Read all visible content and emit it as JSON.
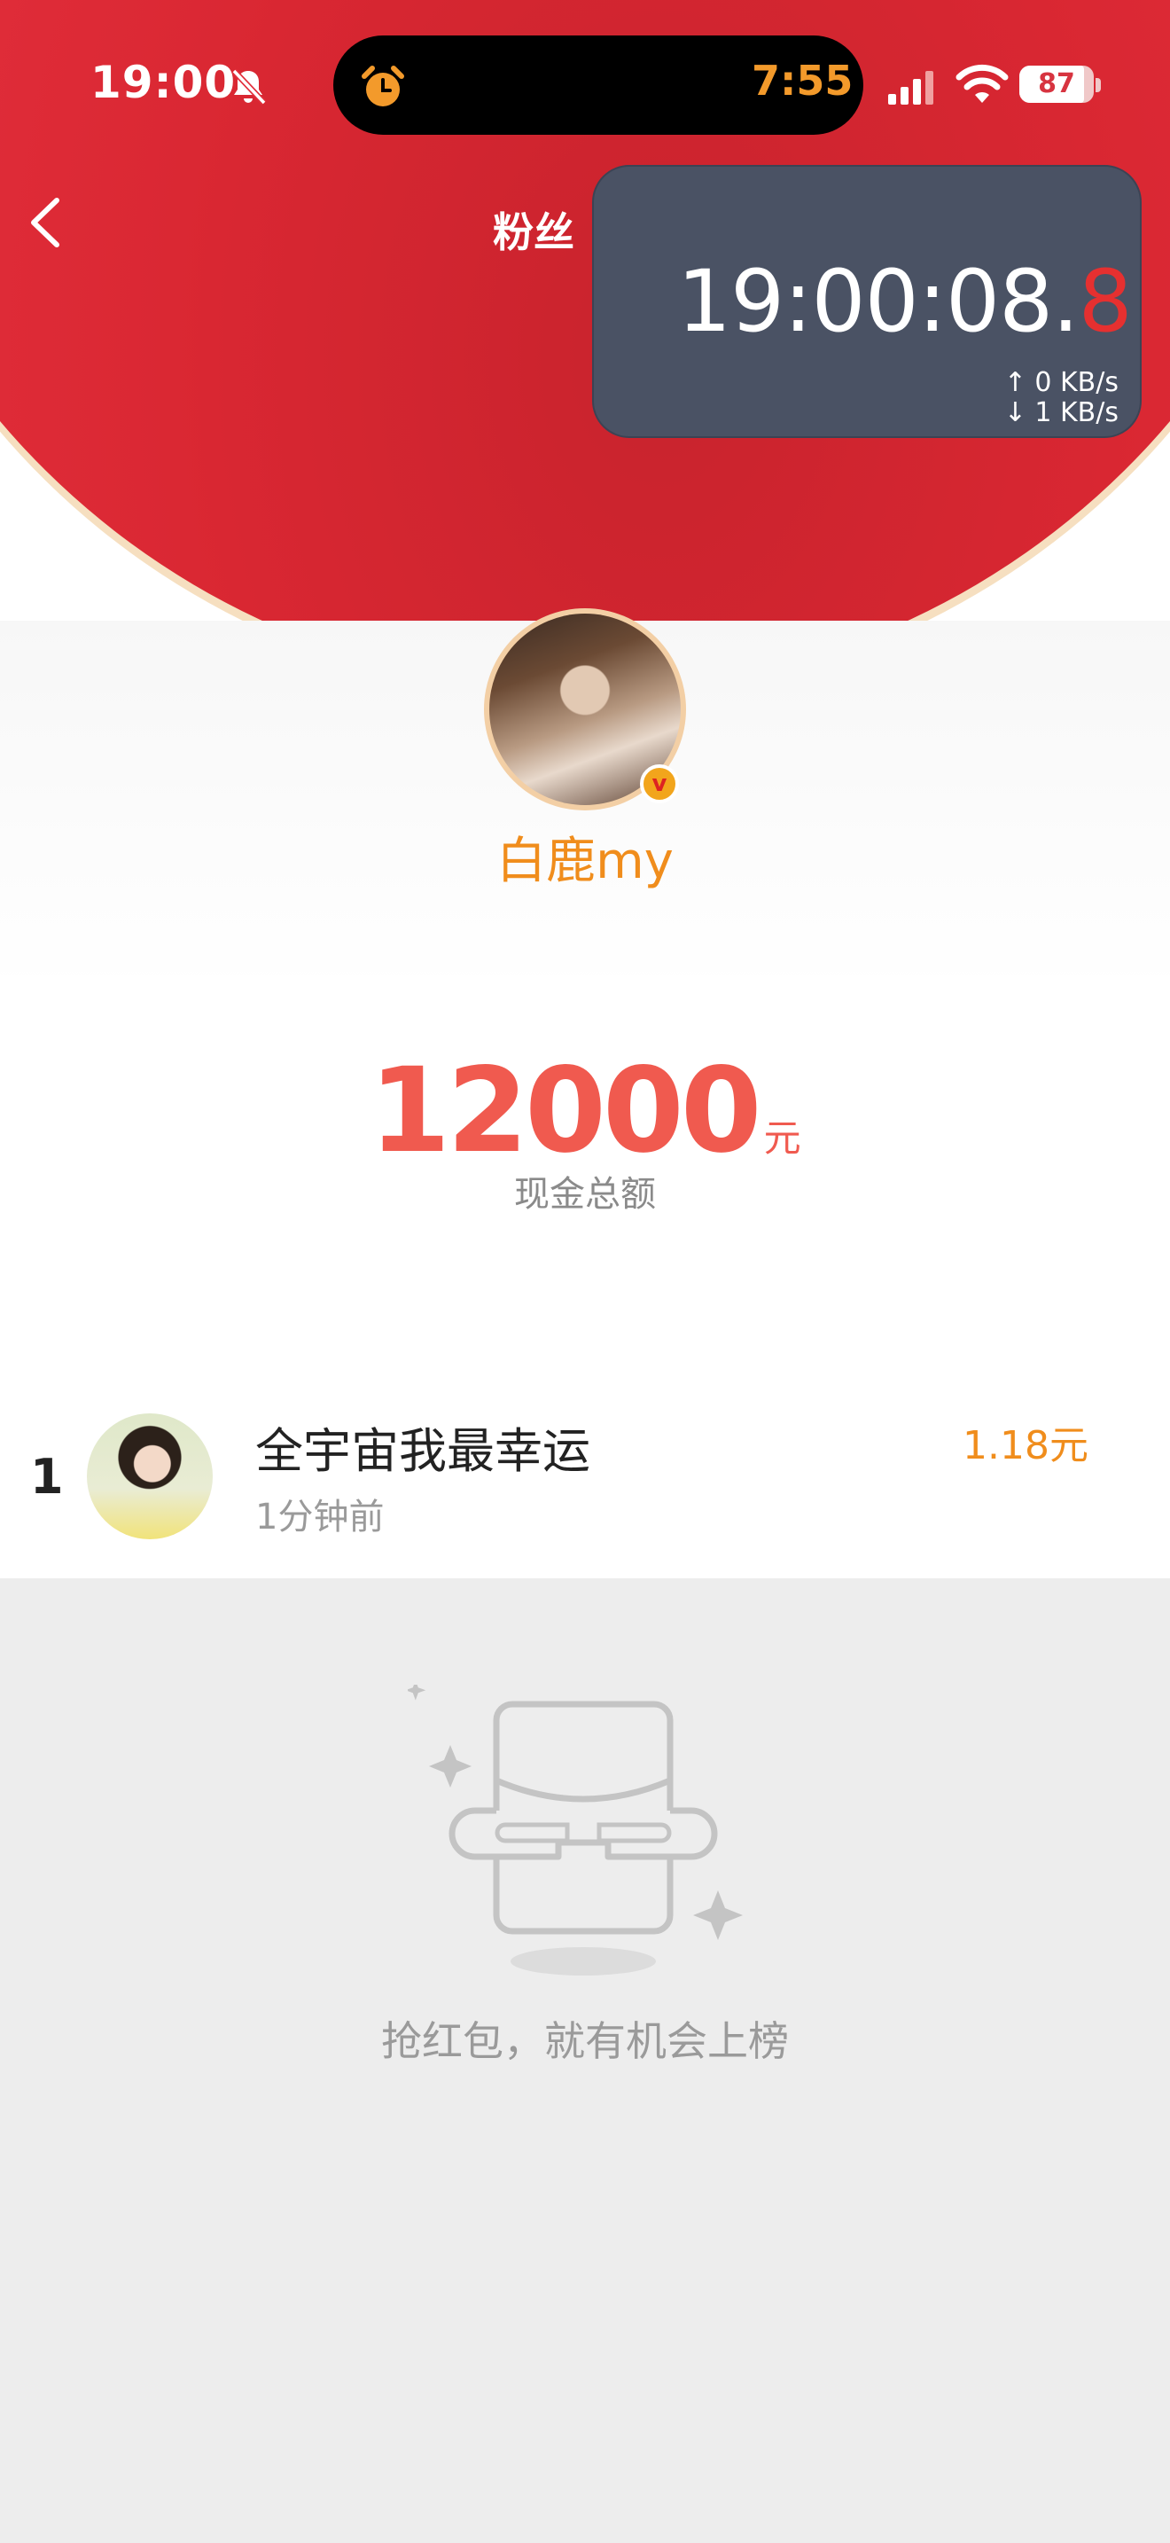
{
  "status_bar": {
    "time": "19:00",
    "island_time": "7:55",
    "battery": "87"
  },
  "nav": {
    "title": "粉丝"
  },
  "clock_overlay": {
    "time_main": "19:00:08.",
    "time_tenths": "8",
    "upload": "↑ 0 KB/s",
    "download": "↓ 1 KB/s"
  },
  "host": {
    "name": "白鹿my",
    "badge": "v"
  },
  "total": {
    "amount": "12000",
    "unit": "元",
    "label": "现金总额"
  },
  "records": [
    {
      "rank": "1",
      "name": "全宇宙我最幸运",
      "time": "1分钟前",
      "amount": "1.18元"
    }
  ],
  "empty_state": {
    "message": "抢红包，就有机会上榜"
  },
  "colors": {
    "header_red": "#e22e3b",
    "accent_orange": "#f08d1c",
    "amount_red": "#f05a4f",
    "overlay_bg": "#4a5264"
  }
}
